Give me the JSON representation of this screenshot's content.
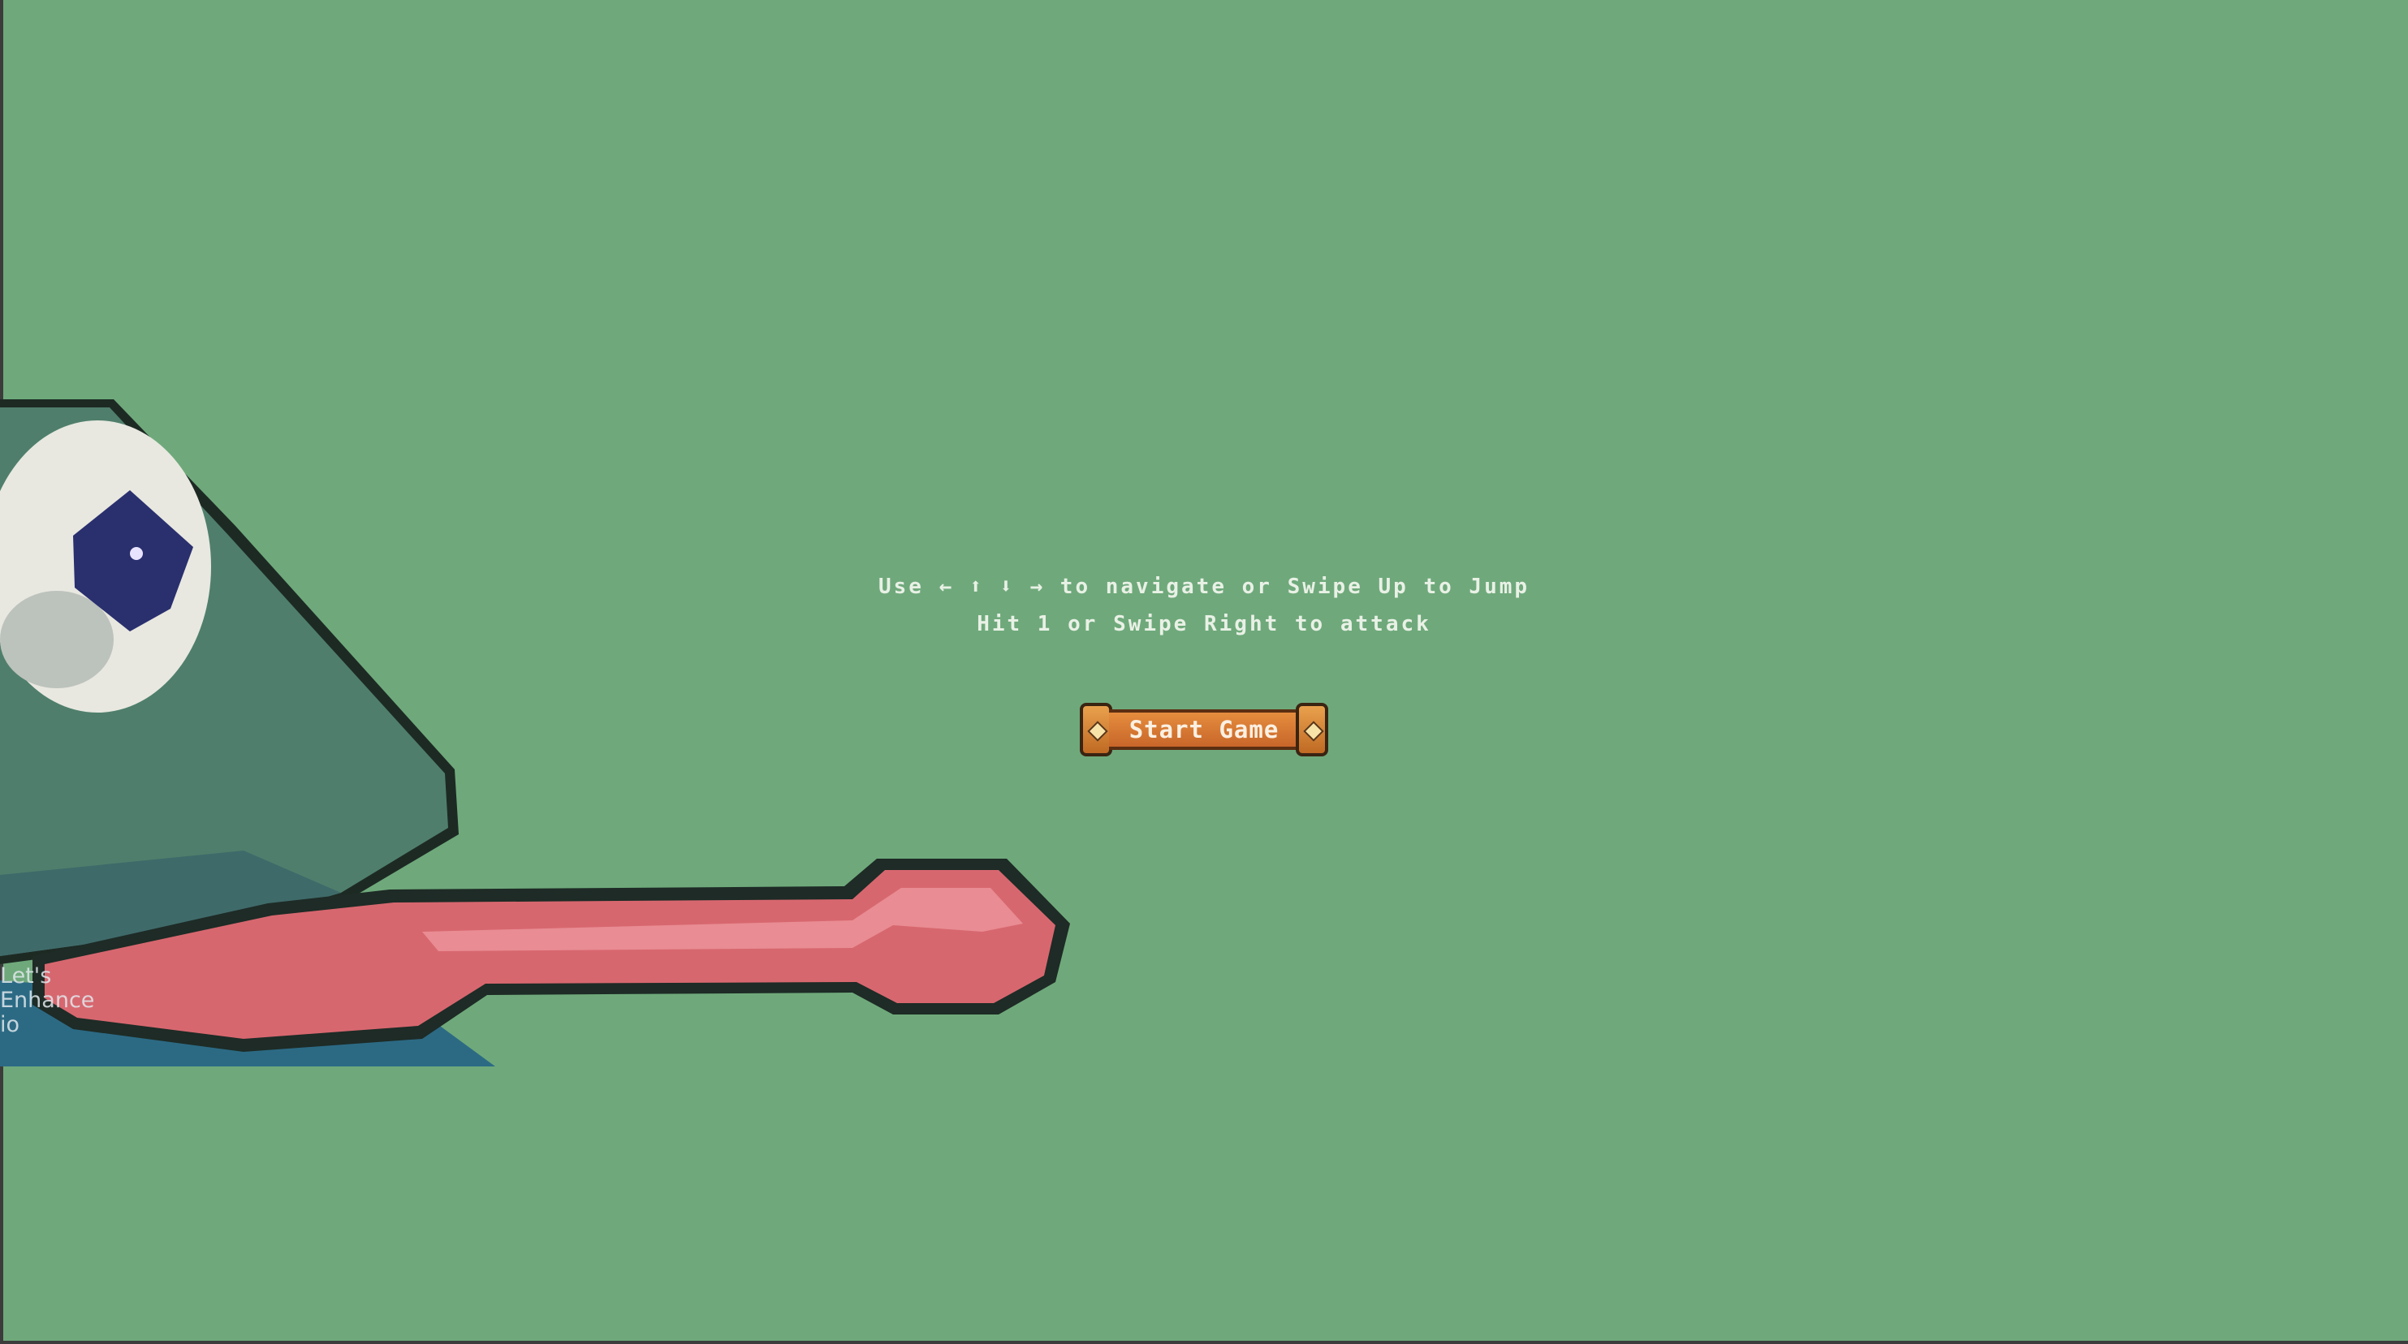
{
  "instructions": {
    "line1": "Use ← ⬆ ⬇ → to navigate or Swipe Up to Jump",
    "line2": "Hit 1 or Swipe Right to attack"
  },
  "start_button": {
    "label": "Start Game"
  },
  "watermark": {
    "text": "Let's\nEnhance\nio"
  },
  "colors": {
    "background": "#6fa97b",
    "button": "#d9793a",
    "frog_body": "#4f7f6c",
    "tongue": "#d96a74",
    "eye_pupil": "#2a2f6e"
  }
}
